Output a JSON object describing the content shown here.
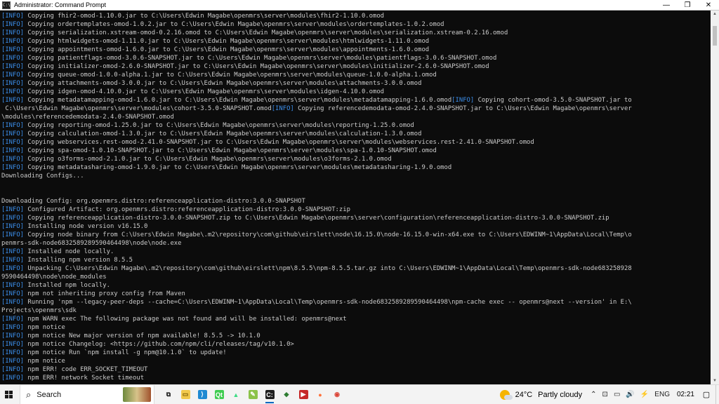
{
  "window": {
    "title": "Administrator: Command Prompt",
    "icon_text": "C:\\",
    "minimize_glyph": "—",
    "maximize_glyph": "❐",
    "close_glyph": "✕"
  },
  "colors": {
    "console_bg": "#0c0c0c",
    "console_fg": "#cccccc",
    "info_tag": "#3b8eea",
    "accent": "#0067c0"
  },
  "console": {
    "lines": [
      {
        "tag": "[INFO]",
        "text": " Copying fhir2-omod-1.10.0.jar to C:\\Users\\Edwin Magabe\\openmrs\\server\\modules\\fhir2-1.10.0.omod"
      },
      {
        "tag": "[INFO]",
        "text": " Copying ordertemplates-omod-1.0.2.jar to C:\\Users\\Edwin Magabe\\openmrs\\server\\modules\\ordertemplates-1.0.2.omod"
      },
      {
        "tag": "[INFO]",
        "text": " Copying serialization.xstream-omod-0.2.16.omod to C:\\Users\\Edwin Magabe\\openmrs\\server\\modules\\serialization.xstream-0.2.16.omod"
      },
      {
        "tag": "[INFO]",
        "text": " Copying htmlwidgets-omod-1.11.0.jar to C:\\Users\\Edwin Magabe\\openmrs\\server\\modules\\htmlwidgets-1.11.0.omod"
      },
      {
        "tag": "[INFO]",
        "text": " Copying appointments-omod-1.6.0.jar to C:\\Users\\Edwin Magabe\\openmrs\\server\\modules\\appointments-1.6.0.omod"
      },
      {
        "tag": "[INFO]",
        "text": " Copying patientflags-omod-3.0.6-SNAPSHOT.jar to C:\\Users\\Edwin Magabe\\openmrs\\server\\modules\\patientflags-3.0.6-SNAPSHOT.omod"
      },
      {
        "tag": "[INFO]",
        "text": " Copying initializer-omod-2.6.0-SNAPSHOT.jar to C:\\Users\\Edwin Magabe\\openmrs\\server\\modules\\initializer-2.6.0-SNAPSHOT.omod"
      },
      {
        "tag": "[INFO]",
        "text": " Copying queue-omod-1.0.0-alpha.1.jar to C:\\Users\\Edwin Magabe\\openmrs\\server\\modules\\queue-1.0.0-alpha.1.omod"
      },
      {
        "tag": "[INFO]",
        "text": " Copying attachments-omod-3.0.0.jar to C:\\Users\\Edwin Magabe\\openmrs\\server\\modules\\attachments-3.0.0.omod"
      },
      {
        "tag": "[INFO]",
        "text": " Copying idgen-omod-4.10.0.jar to C:\\Users\\Edwin Magabe\\openmrs\\server\\modules\\idgen-4.10.0.omod"
      },
      {
        "tag": "[INFO]",
        "text": " Copying metadatamapping-omod-1.6.0.jar to C:\\Users\\Edwin Magabe\\openmrs\\server\\modules\\metadatamapping-1.6.0.omod",
        "tag2": "[INFO]",
        "text2": " Copying cohort-omod-3.5.0-SNAPSHOT.jar to"
      },
      {
        "text": " C:\\Users\\Edwin Magabe\\openmrs\\server\\modules\\cohort-3.5.0-SNAPSHOT.omod",
        "tag2": "[INFO]",
        "text2": " Copying referencedemodata-omod-2.4.0-SNAPSHOT.jar to C:\\Users\\Edwin Magabe\\openmrs\\server"
      },
      {
        "text": "\\modules\\referencedemodata-2.4.0-SNAPSHOT.omod"
      },
      {
        "tag": "[INFO]",
        "text": " Copying reporting-omod-1.25.0.jar to C:\\Users\\Edwin Magabe\\openmrs\\server\\modules\\reporting-1.25.0.omod"
      },
      {
        "tag": "[INFO]",
        "text": " Copying calculation-omod-1.3.0.jar to C:\\Users\\Edwin Magabe\\openmrs\\server\\modules\\calculation-1.3.0.omod"
      },
      {
        "tag": "[INFO]",
        "text": " Copying webservices.rest-omod-2.41.0-SNAPSHOT.jar to C:\\Users\\Edwin Magabe\\openmrs\\server\\modules\\webservices.rest-2.41.0-SNAPSHOT.omod"
      },
      {
        "tag": "[INFO]",
        "text": " Copying spa-omod-1.0.10-SNAPSHOT.jar to C:\\Users\\Edwin Magabe\\openmrs\\server\\modules\\spa-1.0.10-SNAPSHOT.omod"
      },
      {
        "tag": "[INFO]",
        "text": " Copying o3forms-omod-2.1.0.jar to C:\\Users\\Edwin Magabe\\openmrs\\server\\modules\\o3forms-2.1.0.omod"
      },
      {
        "tag": "[INFO]",
        "text": " Copying metadatasharing-omod-1.9.0.jar to C:\\Users\\Edwin Magabe\\openmrs\\server\\modules\\metadatasharing-1.9.0.omod"
      },
      {
        "text": "Downloading Configs..."
      },
      {
        "text": ""
      },
      {
        "text": ""
      },
      {
        "text": "Downloading Config: org.openmrs.distro:referenceapplication-distro:3.0.0-SNAPSHOT"
      },
      {
        "tag": "[INFO]",
        "text": " Configured Artifact: org.openmrs.distro:referenceapplication-distro:3.0.0-SNAPSHOT:zip"
      },
      {
        "tag": "[INFO]",
        "text": " Copying referenceapplication-distro-3.0.0-SNAPSHOT.zip to C:\\Users\\Edwin Magabe\\openmrs\\server\\configuration\\referenceapplication-distro-3.0.0-SNAPSHOT.zip"
      },
      {
        "tag": "[INFO]",
        "text": " Installing node version v16.15.0"
      },
      {
        "tag": "[INFO]",
        "text": " Copying node binary from C:\\Users\\Edwin Magabe\\.m2\\repository\\com\\github\\eirslett\\node\\16.15.0\\node-16.15.0-win-x64.exe to C:\\Users\\EDWINM~1\\AppData\\Local\\Temp\\o"
      },
      {
        "text": "penmrs-sdk-node6832589289590464498\\node\\node.exe"
      },
      {
        "tag": "[INFO]",
        "text": " Installed node locally."
      },
      {
        "tag": "[INFO]",
        "text": " Installing npm version 8.5.5"
      },
      {
        "tag": "[INFO]",
        "text": " Unpacking C:\\Users\\Edwin Magabe\\.m2\\repository\\com\\github\\eirslett\\npm\\8.5.5\\npm-8.5.5.tar.gz into C:\\Users\\EDWINM~1\\AppData\\Local\\Temp\\openmrs-sdk-node683258928"
      },
      {
        "text": "9590464498\\node\\node_modules"
      },
      {
        "tag": "[INFO]",
        "text": " Installed npm locally."
      },
      {
        "tag": "[INFO]",
        "text": " npm not inheriting proxy config from Maven"
      },
      {
        "tag": "[INFO]",
        "text": " Running 'npm --legacy-peer-deps --cache=C:\\Users\\EDWINM~1\\AppData\\Local\\Temp\\openmrs-sdk-node6832589289590464498\\npm-cache exec -- openmrs@next --version' in E:\\"
      },
      {
        "text": "Projects\\openmrs\\sdk"
      },
      {
        "tag": "[INFO]",
        "text": " npm WARN exec The following package was not found and will be installed: openmrs@next"
      },
      {
        "tag": "[INFO]",
        "text": " npm notice"
      },
      {
        "tag": "[INFO]",
        "text": " npm notice New major version of npm available! 8.5.5 -> 10.1.0"
      },
      {
        "tag": "[INFO]",
        "text": " npm notice Changelog: <https://github.com/npm/cli/releases/tag/v10.1.0>"
      },
      {
        "tag": "[INFO]",
        "text": " npm notice Run `npm install -g npm@10.1.0` to update!"
      },
      {
        "tag": "[INFO]",
        "text": " npm notice"
      },
      {
        "tag": "[INFO]",
        "text": " npm ERR! code ERR_SOCKET_TIMEOUT"
      },
      {
        "tag": "[INFO]",
        "text": " npm ERR! network Socket timeout"
      }
    ]
  },
  "taskbar": {
    "search_label": "Search",
    "search_icon": "search-icon",
    "apps": [
      {
        "name": "task-view-icon",
        "glyph": "⧉",
        "bg": "transparent",
        "fg": "#222"
      },
      {
        "name": "file-explorer-icon",
        "glyph": "▭",
        "bg": "#f2c94c",
        "fg": "#7a5a00"
      },
      {
        "name": "vscode-icon",
        "glyph": "⟩",
        "bg": "#1f8ad2",
        "fg": "#fff"
      },
      {
        "name": "qt-creator-icon",
        "glyph": "Qt",
        "bg": "#41cd52",
        "fg": "#fff"
      },
      {
        "name": "android-studio-icon",
        "glyph": "▲",
        "bg": "transparent",
        "fg": "#3ddc84"
      },
      {
        "name": "notepad-icon",
        "glyph": "✎",
        "bg": "#8bc34a",
        "fg": "#fff"
      },
      {
        "name": "command-prompt-icon",
        "glyph": "C:",
        "bg": "#1e1e1e",
        "fg": "#fff"
      },
      {
        "name": "sourcetree-icon",
        "glyph": "◆",
        "bg": "transparent",
        "fg": "#2e7d32"
      },
      {
        "name": "media-player-icon",
        "glyph": "▶",
        "bg": "#c62828",
        "fg": "#fff"
      },
      {
        "name": "firefox-icon",
        "glyph": "●",
        "bg": "transparent",
        "fg": "#ff7139"
      },
      {
        "name": "chrome-icon",
        "glyph": "◉",
        "bg": "transparent",
        "fg": "#db4437"
      }
    ],
    "weather_temp": "24°C",
    "weather_desc": "Partly cloudy",
    "tray_icons": [
      "⌃",
      "⊡",
      "▭",
      "🔊",
      "⚡"
    ],
    "language": "ENG",
    "time": "02:21",
    "notification_glyph": "▢"
  }
}
